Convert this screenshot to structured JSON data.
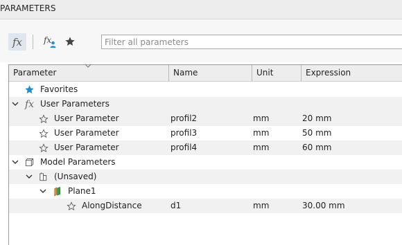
{
  "window": {
    "title": "PARAMETERS"
  },
  "toolbar": {
    "fx_glyph": "fx",
    "user_fx_glyph": "fx",
    "filter_placeholder": "Filter all parameters",
    "filter_value": ""
  },
  "columns": {
    "parameter": "Parameter",
    "name": "Name",
    "unit": "Unit",
    "expression": "Expression"
  },
  "tree": {
    "favorites": {
      "label": "Favorites"
    },
    "user_parameters": {
      "label": "User Parameters",
      "glyph": "fx",
      "items": [
        {
          "label": "User Parameter",
          "name": "profil2",
          "unit": "mm",
          "expression": "20 mm"
        },
        {
          "label": "User Parameter",
          "name": "profil3",
          "unit": "mm",
          "expression": "50 mm"
        },
        {
          "label": "User Parameter",
          "name": "profil4",
          "unit": "mm",
          "expression": "60 mm"
        }
      ]
    },
    "model_parameters": {
      "label": "Model Parameters",
      "unsaved": {
        "label": "(Unsaved)",
        "plane": {
          "label": "Plane1",
          "param": {
            "label": "AlongDistance",
            "name": "d1",
            "unit": "mm",
            "expression": "30.00 mm"
          }
        }
      }
    }
  },
  "icons": {
    "fx_button": "fx-function-icon",
    "user_fx_button": "user-function-icon",
    "favorites_button": "star-icon",
    "favorite_toggle": "star-outline-icon",
    "model_parameters": "cube-icon",
    "unsaved": "component-icon",
    "plane": "plane-icon"
  },
  "colors": {
    "accent_blue": "#1a8fd9",
    "fx_button_bg": "#dfe6ee",
    "header_bg": "#ededed",
    "alt_row": "#f1f1f1"
  }
}
